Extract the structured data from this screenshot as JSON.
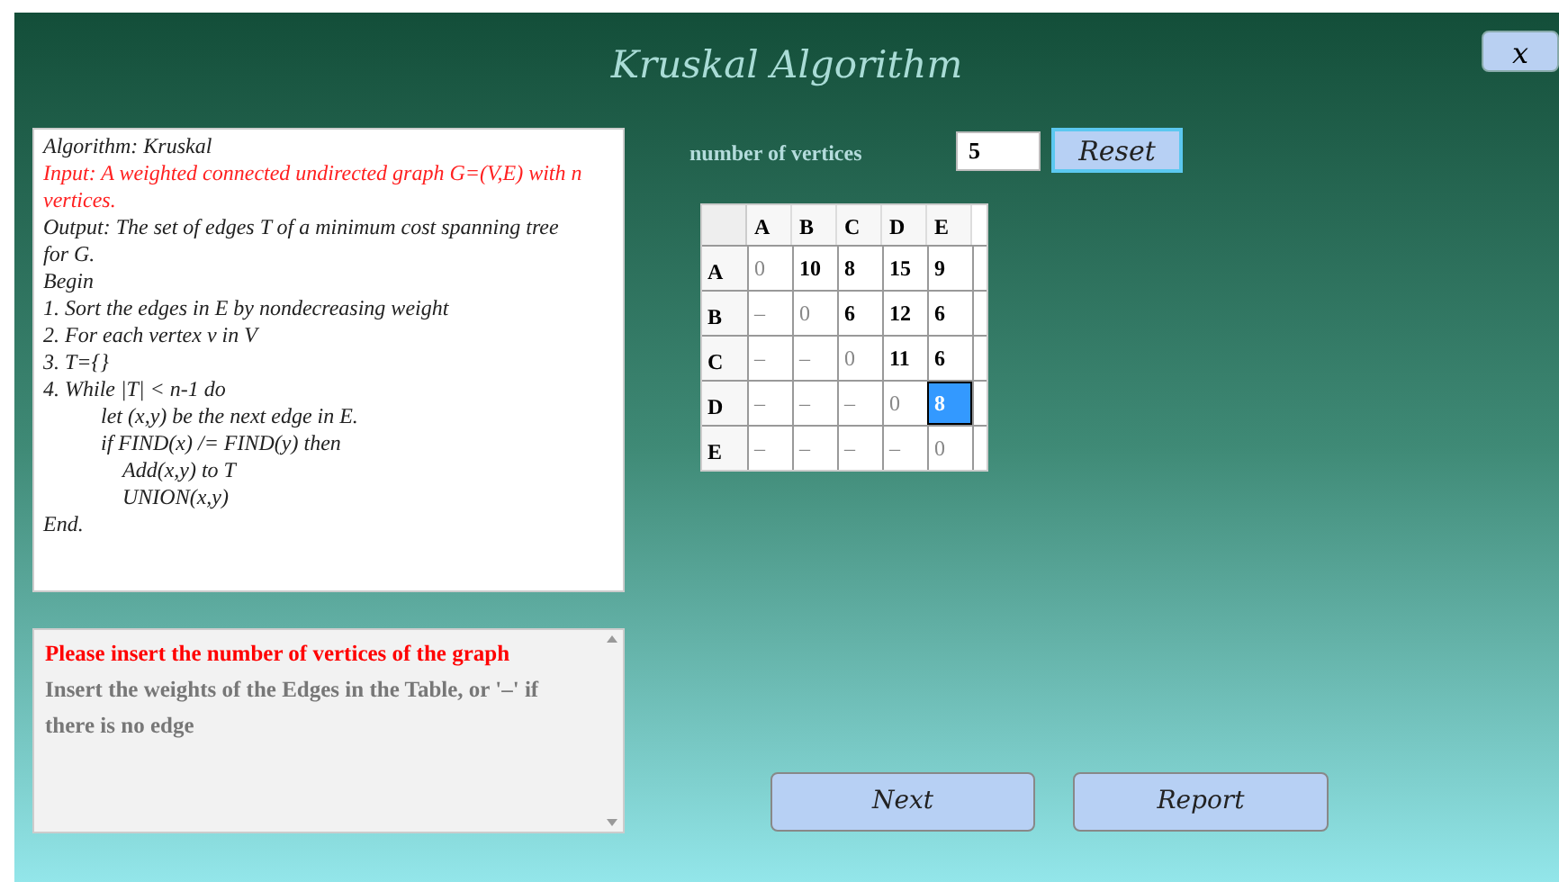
{
  "window": {
    "title": "Kruskal Algorithm",
    "close": "x"
  },
  "algorithm": [
    {
      "text": "Algorithm: Kruskal",
      "kind": "normal"
    },
    {
      "text": "Input: A weighted connected undirected graph G=(V,E) with n vertices.",
      "kind": "input"
    },
    {
      "text": "Output: The set of edges T of a minimum cost spanning tree for G.",
      "kind": "normal"
    },
    {
      "text": "Begin",
      "kind": "normal"
    },
    {
      "text": "1. Sort  the edges in E by nondecreasing weight",
      "kind": "normal"
    },
    {
      "text": "2. For each vertex v in V",
      "kind": "normal"
    },
    {
      "text": "3. T={}",
      "kind": "normal"
    },
    {
      "text": "4. While |T| < n-1 do",
      "kind": "normal",
      "children": [
        {
          "text": "let (x,y) be the next edge in E."
        },
        {
          "text": "if FIND(x) /= FIND(y) then",
          "children": [
            {
              "text": "Add(x,y) to T"
            },
            {
              "text": "UNION(x,y)"
            }
          ]
        }
      ]
    },
    {
      "text": "End.",
      "kind": "normal"
    }
  ],
  "messages": [
    {
      "text": "Please insert the number of vertices of the graph",
      "kind": "error"
    },
    {
      "text": "Insert the weights of the Edges in the Table, or '–' if there is no edge",
      "kind": "hint"
    }
  ],
  "vertices": {
    "label": "number of vertices",
    "value": "5",
    "button": "Reset"
  },
  "matrix": {
    "columns": [
      "A",
      "B",
      "C",
      "D",
      "E"
    ],
    "rows": [
      {
        "label": "A",
        "cells": [
          {
            "value": "0",
            "kind": "dim",
            "selected": false
          },
          {
            "value": "10",
            "kind": "value",
            "selected": false
          },
          {
            "value": "8",
            "kind": "value",
            "selected": false
          },
          {
            "value": "15",
            "kind": "value",
            "selected": false
          },
          {
            "value": "9",
            "kind": "value",
            "selected": false
          }
        ]
      },
      {
        "label": "B",
        "cells": [
          {
            "value": "–",
            "kind": "dim",
            "selected": false
          },
          {
            "value": "0",
            "kind": "dim",
            "selected": false
          },
          {
            "value": "6",
            "kind": "value",
            "selected": false
          },
          {
            "value": "12",
            "kind": "value",
            "selected": false
          },
          {
            "value": "6",
            "kind": "value",
            "selected": false
          }
        ]
      },
      {
        "label": "C",
        "cells": [
          {
            "value": "–",
            "kind": "dim",
            "selected": false
          },
          {
            "value": "–",
            "kind": "dim",
            "selected": false
          },
          {
            "value": "0",
            "kind": "dim",
            "selected": false
          },
          {
            "value": "11",
            "kind": "value",
            "selected": false
          },
          {
            "value": "6",
            "kind": "value",
            "selected": false
          }
        ]
      },
      {
        "label": "D",
        "cells": [
          {
            "value": "–",
            "kind": "dim",
            "selected": false
          },
          {
            "value": "–",
            "kind": "dim",
            "selected": false
          },
          {
            "value": "–",
            "kind": "dim",
            "selected": false
          },
          {
            "value": "0",
            "kind": "dim",
            "selected": false
          },
          {
            "value": "8",
            "kind": "value",
            "selected": true
          }
        ]
      },
      {
        "label": "E",
        "cells": [
          {
            "value": "–",
            "kind": "dim",
            "selected": false
          },
          {
            "value": "–",
            "kind": "dim",
            "selected": false
          },
          {
            "value": "–",
            "kind": "dim",
            "selected": false
          },
          {
            "value": "–",
            "kind": "dim",
            "selected": false
          },
          {
            "value": "0",
            "kind": "dim",
            "selected": false
          }
        ]
      }
    ]
  },
  "buttons": [
    "Next",
    "Report"
  ]
}
